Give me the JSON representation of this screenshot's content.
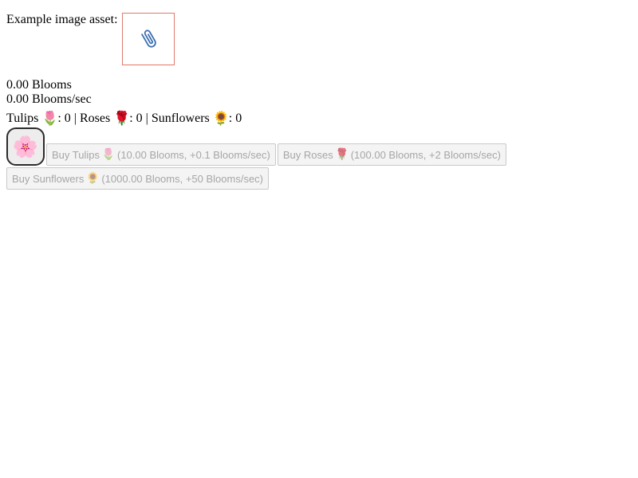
{
  "asset": {
    "label": "Example image asset:",
    "icon": "paperclip-icon"
  },
  "stats": {
    "blooms": "0.00 Blooms",
    "rate": "0.00 Blooms/sec"
  },
  "counts": {
    "tulips_label": "Tulips",
    "tulips_emoji": "🌷",
    "tulips_value": ": 0",
    "sep1": " | ",
    "roses_label": "Roses",
    "roses_emoji": "🌹",
    "roses_value": ": 0",
    "sep2": " | ",
    "sunflowers_label": "Sunflowers",
    "sunflowers_emoji": "🌻",
    "sunflowers_value": ": 0"
  },
  "flower_button": {
    "emoji": "🌸"
  },
  "buy_buttons": {
    "tulips": {
      "prefix": "Buy Tulips",
      "emoji": "🌷",
      "suffix": "(10.00 Blooms, +0.1 Blooms/sec)"
    },
    "roses": {
      "prefix": "Buy Roses",
      "emoji": "🌹",
      "suffix": "(100.00 Blooms, +2 Blooms/sec)"
    },
    "sunflowers": {
      "prefix": "Buy Sunflowers",
      "emoji": "🌻",
      "suffix": "(1000.00 Blooms, +50 Blooms/sec)"
    }
  },
  "colors": {
    "asset_border": "#e07a6a",
    "paperclip": "#3a6fb0",
    "disabled_text": "#a6a6a6"
  }
}
